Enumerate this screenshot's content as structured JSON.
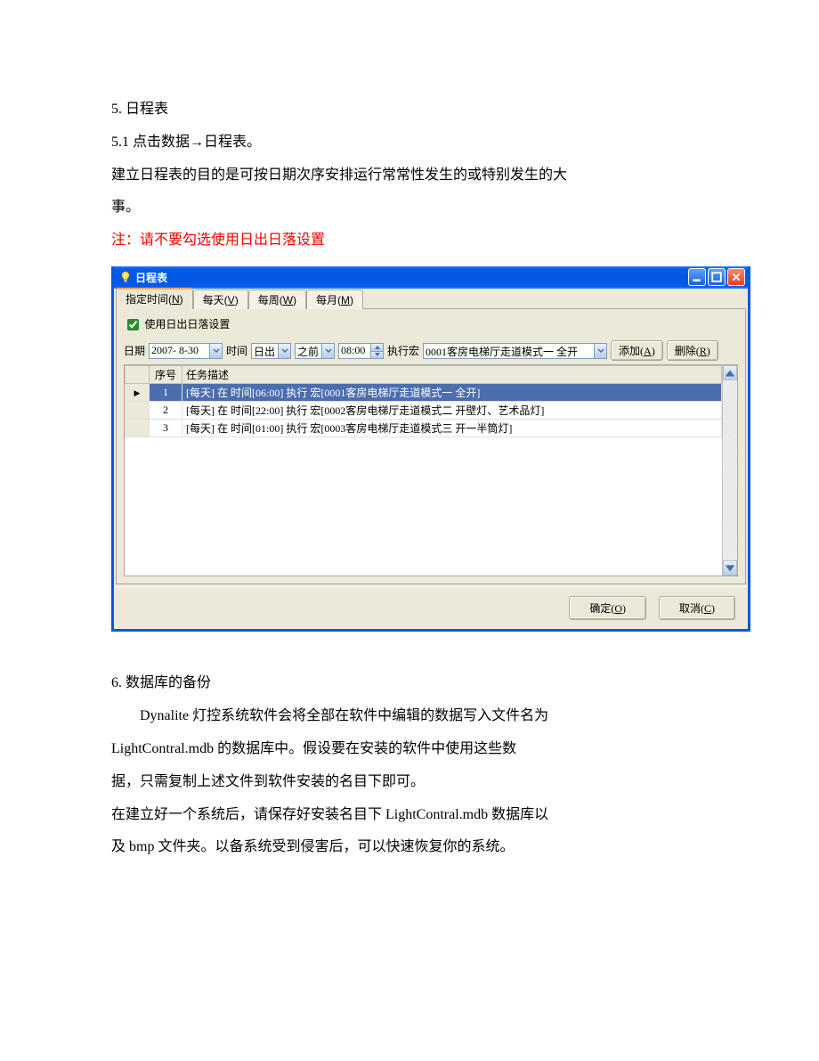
{
  "section5": {
    "heading": "5. 日程表",
    "sub": "5.1 点击数据→日程表。",
    "p1": "建立日程表的目的是可按日期次序安排运行常常性发生的或特别发生的大",
    "p1b": "事。",
    "note": "注：请不要勾选使用日出日落设置"
  },
  "dialog": {
    "title": "日程表",
    "tabs": {
      "t1": {
        "label": "指定时间(",
        "u": "N",
        "tail": ")"
      },
      "t2": {
        "label": "每天(",
        "u": "V",
        "tail": ")"
      },
      "t3": {
        "label": "每周(",
        "u": "W",
        "tail": ")"
      },
      "t4": {
        "label": "每月(",
        "u": "M",
        "tail": ")"
      }
    },
    "check_label": "使用日出日落设置",
    "form": {
      "l_date": "日期",
      "date_value": "2007- 8-30",
      "l_time": "时间",
      "time_kind": "日出",
      "time_rel": "之前",
      "time_value": "08:00",
      "l_macro": "执行宏",
      "macro_value": "0001客房电梯厅走道模式一 全开",
      "btn_add": {
        "label": "添加(",
        "u": "A",
        "tail": ")"
      },
      "btn_del": {
        "label": "删除(",
        "u": "R",
        "tail": ")"
      }
    },
    "grid": {
      "col1": "序号",
      "col2": "任务描述",
      "rows": [
        {
          "n": "1",
          "desc": "[每天] 在 时间[06:00] 执行 宏[0001客房电梯厅走道模式一 全开]",
          "selected": true
        },
        {
          "n": "2",
          "desc": "[每天] 在 时间[22:00] 执行 宏[0002客房电梯厅走道模式二 开壁灯、艺术品灯]",
          "selected": false
        },
        {
          "n": "3",
          "desc": "[每天] 在 时间[01:00] 执行 宏[0003客房电梯厅走道模式三 开一半筒灯]",
          "selected": false
        }
      ]
    },
    "footer": {
      "ok": {
        "label": "确定(",
        "u": "O",
        "tail": ")"
      },
      "cancel": {
        "label": "取消(",
        "u": "C",
        "tail": ")"
      }
    }
  },
  "section6": {
    "heading": "6. 数据库的备份",
    "p1": "　　Dynalite 灯控系统软件会将全部在软件中编辑的数据写入文件名为",
    "p2": "LightContral.mdb 的数据库中。假设要在安装的软件中使用这些数",
    "p3": "据，只需复制上述文件到软件安装的名目下即可。",
    "p4": "在建立好一个系统后，请保存好安装名目下 LightContral.mdb  数据库以",
    "p5": "及 bmp 文件夹。以备系统受到侵害后，可以快速恢复你的系统。"
  }
}
